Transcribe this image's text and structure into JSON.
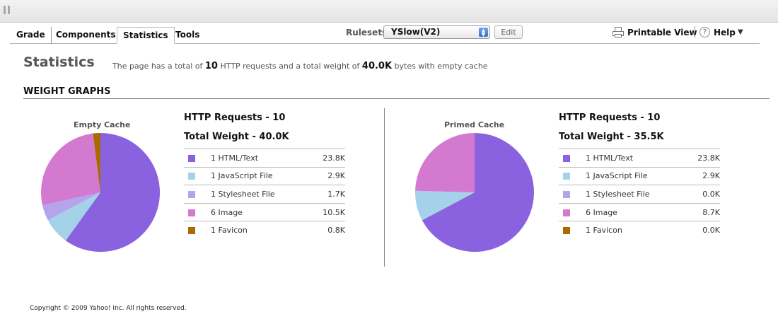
{
  "toolbar": {
    "tabs": [
      "Grade",
      "Components",
      "Statistics",
      "Tools"
    ],
    "rulesets_label": "Rulesets",
    "ruleset_selected": "YSlow(V2)",
    "edit_label": "Edit",
    "printable_view_label": "Printable View",
    "help_label": "Help",
    "icons": [
      "pause-icon",
      "select-arrow-icon",
      "printer-icon",
      "question-icon",
      "caret-down-icon"
    ]
  },
  "main": {
    "title": "Statistics",
    "summary_prefix": "The page has a total of ",
    "summary_requests": "10",
    "summary_middle": " HTTP requests and a total weight of ",
    "summary_weight": "40.0K",
    "summary_suffix": " bytes with empty cache"
  },
  "section_title": "WEIGHT GRAPHS",
  "colors": {
    "HTML/Text": "#8a62e0",
    "JavaScript File": "#a4d2e8",
    "Stylesheet File": "#b3a4ec",
    "Image": "#d479d0",
    "Favicon": "#a86b00"
  },
  "chart_data": [
    {
      "type": "pie",
      "title": "Empty Cache",
      "requests_label": "HTTP Requests - 10",
      "weight_label": "Total Weight - 40.0K",
      "rows": [
        {
          "count": "1",
          "label": "HTML/Text",
          "size": "23.8K",
          "value": 23.8
        },
        {
          "count": "1",
          "label": "JavaScript File",
          "size": "2.9K",
          "value": 2.9
        },
        {
          "count": "1",
          "label": "Stylesheet File",
          "size": "1.7K",
          "value": 1.7
        },
        {
          "count": "6",
          "label": "Image",
          "size": "10.5K",
          "value": 10.5
        },
        {
          "count": "1",
          "label": "Favicon",
          "size": "0.8K",
          "value": 0.8
        }
      ]
    },
    {
      "type": "pie",
      "title": "Primed Cache",
      "requests_label": "HTTP Requests - 10",
      "weight_label": "Total Weight - 35.5K",
      "rows": [
        {
          "count": "1",
          "label": "HTML/Text",
          "size": "23.8K",
          "value": 23.8
        },
        {
          "count": "1",
          "label": "JavaScript File",
          "size": "2.9K",
          "value": 2.9
        },
        {
          "count": "1",
          "label": "Stylesheet File",
          "size": "0.0K",
          "value": 0.0
        },
        {
          "count": "6",
          "label": "Image",
          "size": "8.7K",
          "value": 8.7
        },
        {
          "count": "1",
          "label": "Favicon",
          "size": "0.0K",
          "value": 0.0
        }
      ]
    }
  ],
  "footer": {
    "copyright": "Copyright © 2009 Yahoo! Inc. All rights reserved."
  }
}
